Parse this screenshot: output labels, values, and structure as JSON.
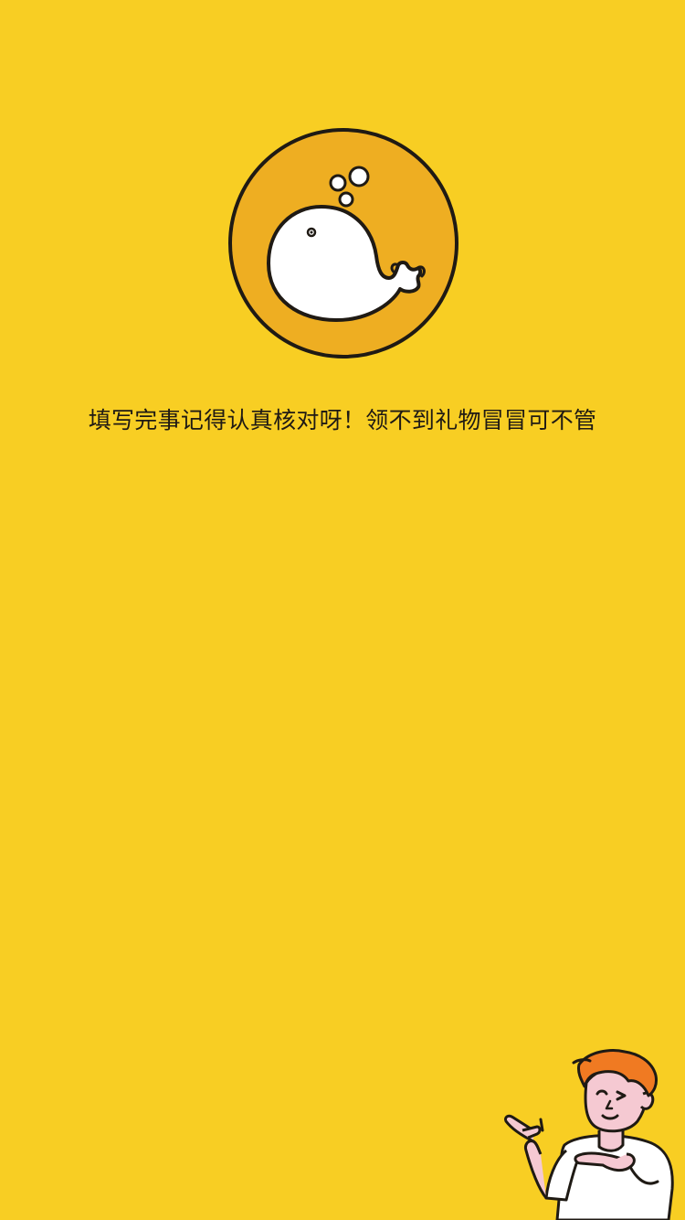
{
  "notice": {
    "text": "填写完事记得认真核对呀！领不到礼物冒冒可不管"
  },
  "logo": {
    "icon": "whale-icon"
  },
  "mascot": {
    "icon": "pointing-boy-illustration"
  },
  "colors": {
    "background": "#F8CE23",
    "logo_circle": "#EEAE22",
    "text": "#1F1A14",
    "hair": "#F07A22",
    "skin": "#F5C9D2"
  }
}
